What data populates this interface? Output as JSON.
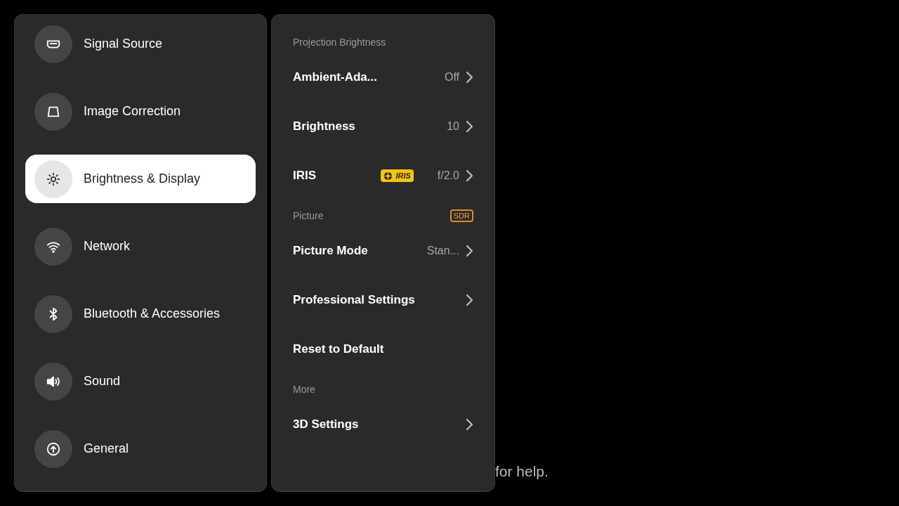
{
  "background_hint": {
    "text": "for help."
  },
  "sidebar": {
    "items": [
      {
        "label": "Signal Source",
        "kind": "hdmi",
        "selected": false
      },
      {
        "label": "Image Correction",
        "kind": "trapezoid",
        "selected": false
      },
      {
        "label": "Brightness & Display",
        "kind": "sun",
        "selected": true
      },
      {
        "label": "Network",
        "kind": "wifi",
        "selected": false
      },
      {
        "label": "Bluetooth & Accessories",
        "kind": "bluetooth",
        "selected": false
      },
      {
        "label": "Sound",
        "kind": "speaker",
        "selected": false
      },
      {
        "label": "General",
        "kind": "upload",
        "selected": false
      }
    ]
  },
  "settings": {
    "sections": [
      {
        "title": "Projection Brightness",
        "rows": [
          {
            "label": "Ambient-Ada...",
            "value": "Off",
            "chevron": true
          },
          {
            "label": "Brightness",
            "value": "10",
            "chevron": true
          },
          {
            "label": "IRIS",
            "badge": {
              "text": "IRIS",
              "kind": "iris"
            },
            "value": "f/2.0",
            "chevron": true
          }
        ]
      },
      {
        "title": "Picture",
        "badge": {
          "text": "SDR",
          "kind": "sdr"
        },
        "rows": [
          {
            "label": "Picture Mode",
            "value": "Stan...",
            "chevron": true
          },
          {
            "label": "Professional Settings",
            "chevron": true
          },
          {
            "label": "Reset to Default",
            "chevron": false
          }
        ]
      },
      {
        "title": "More",
        "rows": [
          {
            "label": "3D Settings",
            "chevron": true
          }
        ]
      }
    ]
  }
}
